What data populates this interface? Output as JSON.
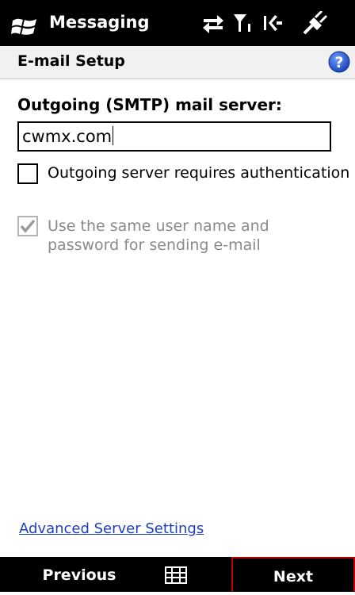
{
  "statusbar": {
    "app_title": "Messaging",
    "icons": [
      "windows-start-icon",
      "data-connection-icon",
      "signal-strength-icon",
      "volume-icon",
      "power-plug-icon"
    ]
  },
  "titlebar": {
    "title": "E-mail Setup",
    "help_icon": "help-icon"
  },
  "form": {
    "server_label": "Outgoing (SMTP) mail server:",
    "server_value": "cwmx.com",
    "auth_checkbox": {
      "label": "Outgoing server requires authentication",
      "checked": false
    },
    "same_cred_checkbox": {
      "label": "Use the same user name and password for sending e-mail",
      "checked": true,
      "enabled": false
    }
  },
  "advanced_link": "Advanced Server Settings",
  "softkeys": {
    "left": "Previous",
    "right": "Next",
    "input_icon": "keyboard-icon"
  },
  "colors": {
    "bar": "#000000",
    "link": "#1f3fb6",
    "highlight_border": "#c00000",
    "disabled_text": "#8a8a8a"
  }
}
